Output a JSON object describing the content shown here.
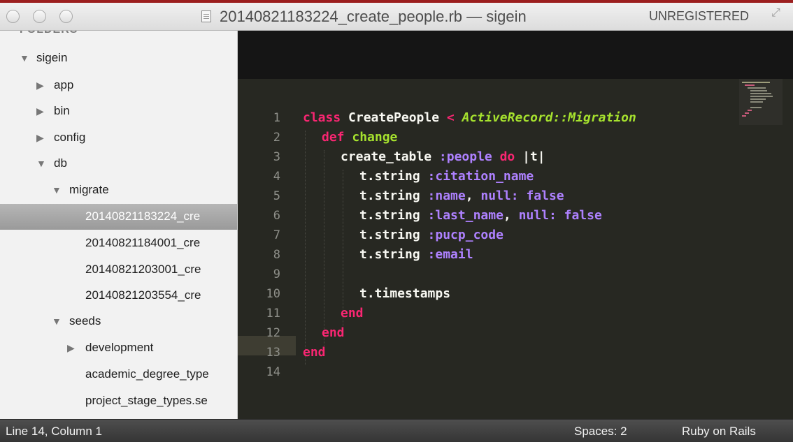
{
  "window": {
    "title": "20140821183224_create_people.rb — sigein",
    "registration": "UNREGISTERED",
    "controls": [
      "close-icon",
      "minimize-icon",
      "zoom-icon"
    ],
    "fullscreen_icon": "fullscreen-icon"
  },
  "sidebar": {
    "header": "FOLDERS",
    "items": [
      {
        "label": "sigein",
        "type": "folder-open"
      },
      {
        "label": "app",
        "type": "folder-closed"
      },
      {
        "label": "bin",
        "type": "folder-closed"
      },
      {
        "label": "config",
        "type": "folder-closed"
      },
      {
        "label": "db",
        "type": "folder-open"
      },
      {
        "label": "migrate",
        "type": "folder-open"
      },
      {
        "label": "20140821183224_cre",
        "type": "file",
        "selected": true
      },
      {
        "label": "20140821184001_cre",
        "type": "file"
      },
      {
        "label": "20140821203001_cre",
        "type": "file"
      },
      {
        "label": "20140821203554_cre",
        "type": "file"
      },
      {
        "label": "seeds",
        "type": "folder-open"
      },
      {
        "label": "development",
        "type": "folder-closed"
      },
      {
        "label": "academic_degree_type",
        "type": "file"
      },
      {
        "label": "project_stage_types.se",
        "type": "file"
      }
    ]
  },
  "editor": {
    "current_line": 14,
    "line_numbers": [
      "1",
      "2",
      "3",
      "4",
      "5",
      "6",
      "7",
      "8",
      "9",
      "10",
      "11",
      "12",
      "13",
      "14"
    ],
    "code": {
      "l1_kw": "class",
      "l1_name": " CreatePeople ",
      "l1_op": "<",
      "l1_super": " ActiveRecord::Migration",
      "l2_kw": "def",
      "l2_name": " change",
      "l3_a": "create_table ",
      "l3_sym": ":people",
      "l3_kw": " do ",
      "l3_b": "|t|",
      "l4_a": "t.string ",
      "l4_sym": ":citation_name",
      "l5_a": "t.string ",
      "l5_sym": ":name",
      "l5_b": ", ",
      "l5_c": "null: false",
      "l6_a": "t.string ",
      "l6_sym": ":last_name",
      "l6_b": ", ",
      "l6_c": "null: false",
      "l7_a": "t.string ",
      "l7_sym": ":pucp_code",
      "l8_a": "t.string ",
      "l8_sym": ":email",
      "l10_a": "t.timestamps",
      "l11_kw": "end",
      "l12_kw": "end",
      "l13_kw": "end"
    },
    "colors": {
      "background": "#272822",
      "keyword": "#f92672",
      "function": "#a6e22e",
      "symbol": "#ae81ff",
      "text": "#f8f8f2",
      "line_number": "#8f908a"
    }
  },
  "statusbar": {
    "position": "Line 14, Column 1",
    "indentation": "Spaces: 2",
    "syntax": "Ruby on Rails"
  }
}
